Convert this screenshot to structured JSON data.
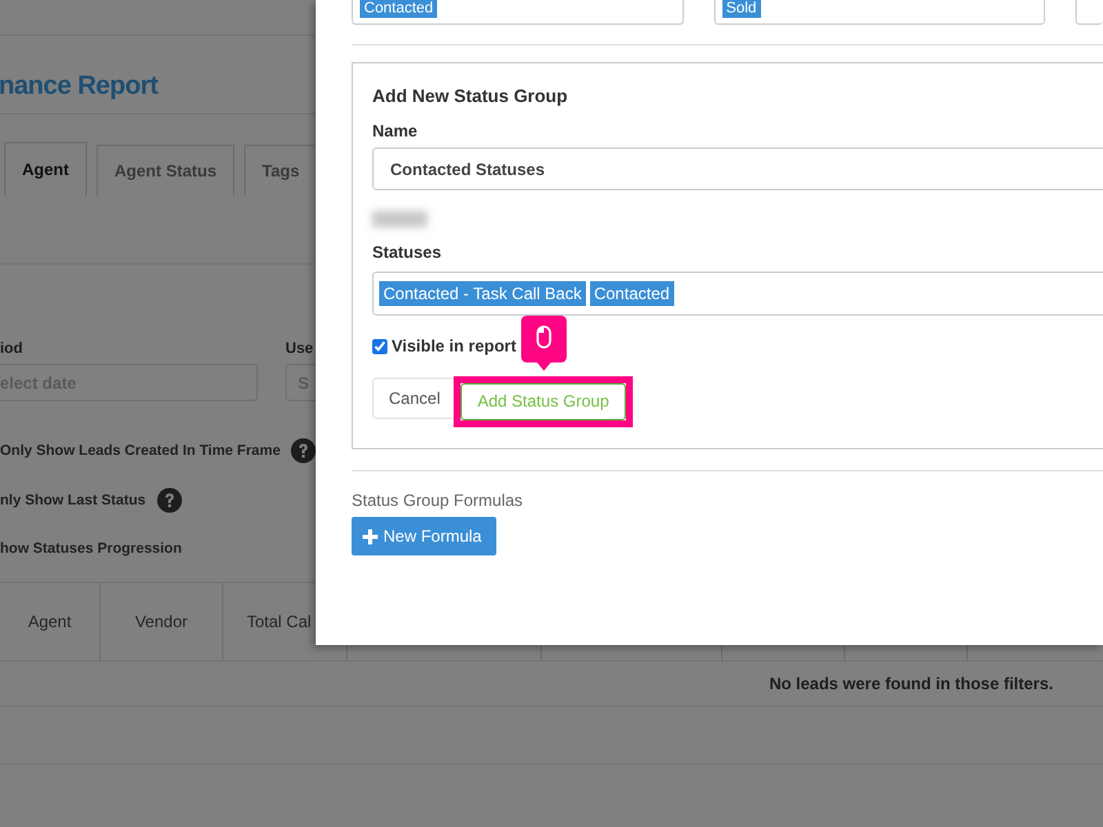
{
  "page": {
    "title": "nance Report",
    "tabs": [
      {
        "label": "Agent",
        "selected": true
      },
      {
        "label": "Agent Status",
        "selected": false
      },
      {
        "label": "Tags",
        "selected": false
      }
    ],
    "filters": [
      {
        "label": "iod",
        "placeholder": "elect date"
      },
      {
        "label": "Use",
        "placeholder": "S"
      }
    ],
    "options": [
      {
        "label": "Only Show Leads Created In Time Frame",
        "help": true
      },
      {
        "label": "nly Show Last Status",
        "help": true
      },
      {
        "label": "how Statuses Progression",
        "help": false
      }
    ],
    "table": {
      "columns": [
        "Agent",
        "Vendor",
        "Total Cal"
      ],
      "empty_message": "No leads were found in those filters."
    }
  },
  "modal": {
    "top_fields": [
      {
        "tags": [
          "Contacted"
        ]
      },
      {
        "tags": [
          "Sold"
        ]
      }
    ],
    "group_form": {
      "heading": "Add New Status Group",
      "name_label": "Name",
      "name_value": "Contacted Statuses",
      "statuses_label": "Statuses",
      "statuses": [
        "Contacted - Task Call Back",
        "Contacted"
      ],
      "visible": {
        "label": "Visible in report",
        "checked": true
      },
      "buttons": [
        {
          "label": "Cancel",
          "kind": "default",
          "highlighted": false
        },
        {
          "label": "Add Status Group",
          "kind": "success",
          "highlighted": true
        }
      ]
    },
    "formulas": {
      "heading": "Status Group Formulas",
      "button": "New Formula"
    }
  }
}
